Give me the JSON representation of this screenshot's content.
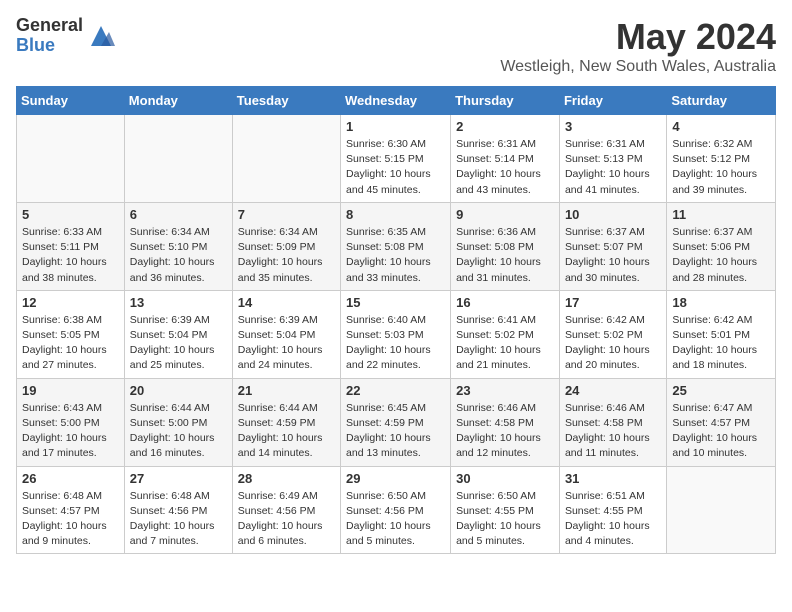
{
  "logo": {
    "general": "General",
    "blue": "Blue"
  },
  "title": "May 2024",
  "subtitle": "Westleigh, New South Wales, Australia",
  "days_of_week": [
    "Sunday",
    "Monday",
    "Tuesday",
    "Wednesday",
    "Thursday",
    "Friday",
    "Saturday"
  ],
  "weeks": [
    [
      {
        "day": "",
        "info": ""
      },
      {
        "day": "",
        "info": ""
      },
      {
        "day": "",
        "info": ""
      },
      {
        "day": "1",
        "info": "Sunrise: 6:30 AM\nSunset: 5:15 PM\nDaylight: 10 hours\nand 45 minutes."
      },
      {
        "day": "2",
        "info": "Sunrise: 6:31 AM\nSunset: 5:14 PM\nDaylight: 10 hours\nand 43 minutes."
      },
      {
        "day": "3",
        "info": "Sunrise: 6:31 AM\nSunset: 5:13 PM\nDaylight: 10 hours\nand 41 minutes."
      },
      {
        "day": "4",
        "info": "Sunrise: 6:32 AM\nSunset: 5:12 PM\nDaylight: 10 hours\nand 39 minutes."
      }
    ],
    [
      {
        "day": "5",
        "info": "Sunrise: 6:33 AM\nSunset: 5:11 PM\nDaylight: 10 hours\nand 38 minutes."
      },
      {
        "day": "6",
        "info": "Sunrise: 6:34 AM\nSunset: 5:10 PM\nDaylight: 10 hours\nand 36 minutes."
      },
      {
        "day": "7",
        "info": "Sunrise: 6:34 AM\nSunset: 5:09 PM\nDaylight: 10 hours\nand 35 minutes."
      },
      {
        "day": "8",
        "info": "Sunrise: 6:35 AM\nSunset: 5:08 PM\nDaylight: 10 hours\nand 33 minutes."
      },
      {
        "day": "9",
        "info": "Sunrise: 6:36 AM\nSunset: 5:08 PM\nDaylight: 10 hours\nand 31 minutes."
      },
      {
        "day": "10",
        "info": "Sunrise: 6:37 AM\nSunset: 5:07 PM\nDaylight: 10 hours\nand 30 minutes."
      },
      {
        "day": "11",
        "info": "Sunrise: 6:37 AM\nSunset: 5:06 PM\nDaylight: 10 hours\nand 28 minutes."
      }
    ],
    [
      {
        "day": "12",
        "info": "Sunrise: 6:38 AM\nSunset: 5:05 PM\nDaylight: 10 hours\nand 27 minutes."
      },
      {
        "day": "13",
        "info": "Sunrise: 6:39 AM\nSunset: 5:04 PM\nDaylight: 10 hours\nand 25 minutes."
      },
      {
        "day": "14",
        "info": "Sunrise: 6:39 AM\nSunset: 5:04 PM\nDaylight: 10 hours\nand 24 minutes."
      },
      {
        "day": "15",
        "info": "Sunrise: 6:40 AM\nSunset: 5:03 PM\nDaylight: 10 hours\nand 22 minutes."
      },
      {
        "day": "16",
        "info": "Sunrise: 6:41 AM\nSunset: 5:02 PM\nDaylight: 10 hours\nand 21 minutes."
      },
      {
        "day": "17",
        "info": "Sunrise: 6:42 AM\nSunset: 5:02 PM\nDaylight: 10 hours\nand 20 minutes."
      },
      {
        "day": "18",
        "info": "Sunrise: 6:42 AM\nSunset: 5:01 PM\nDaylight: 10 hours\nand 18 minutes."
      }
    ],
    [
      {
        "day": "19",
        "info": "Sunrise: 6:43 AM\nSunset: 5:00 PM\nDaylight: 10 hours\nand 17 minutes."
      },
      {
        "day": "20",
        "info": "Sunrise: 6:44 AM\nSunset: 5:00 PM\nDaylight: 10 hours\nand 16 minutes."
      },
      {
        "day": "21",
        "info": "Sunrise: 6:44 AM\nSunset: 4:59 PM\nDaylight: 10 hours\nand 14 minutes."
      },
      {
        "day": "22",
        "info": "Sunrise: 6:45 AM\nSunset: 4:59 PM\nDaylight: 10 hours\nand 13 minutes."
      },
      {
        "day": "23",
        "info": "Sunrise: 6:46 AM\nSunset: 4:58 PM\nDaylight: 10 hours\nand 12 minutes."
      },
      {
        "day": "24",
        "info": "Sunrise: 6:46 AM\nSunset: 4:58 PM\nDaylight: 10 hours\nand 11 minutes."
      },
      {
        "day": "25",
        "info": "Sunrise: 6:47 AM\nSunset: 4:57 PM\nDaylight: 10 hours\nand 10 minutes."
      }
    ],
    [
      {
        "day": "26",
        "info": "Sunrise: 6:48 AM\nSunset: 4:57 PM\nDaylight: 10 hours\nand 9 minutes."
      },
      {
        "day": "27",
        "info": "Sunrise: 6:48 AM\nSunset: 4:56 PM\nDaylight: 10 hours\nand 7 minutes."
      },
      {
        "day": "28",
        "info": "Sunrise: 6:49 AM\nSunset: 4:56 PM\nDaylight: 10 hours\nand 6 minutes."
      },
      {
        "day": "29",
        "info": "Sunrise: 6:50 AM\nSunset: 4:56 PM\nDaylight: 10 hours\nand 5 minutes."
      },
      {
        "day": "30",
        "info": "Sunrise: 6:50 AM\nSunset: 4:55 PM\nDaylight: 10 hours\nand 5 minutes."
      },
      {
        "day": "31",
        "info": "Sunrise: 6:51 AM\nSunset: 4:55 PM\nDaylight: 10 hours\nand 4 minutes."
      },
      {
        "day": "",
        "info": ""
      }
    ]
  ]
}
